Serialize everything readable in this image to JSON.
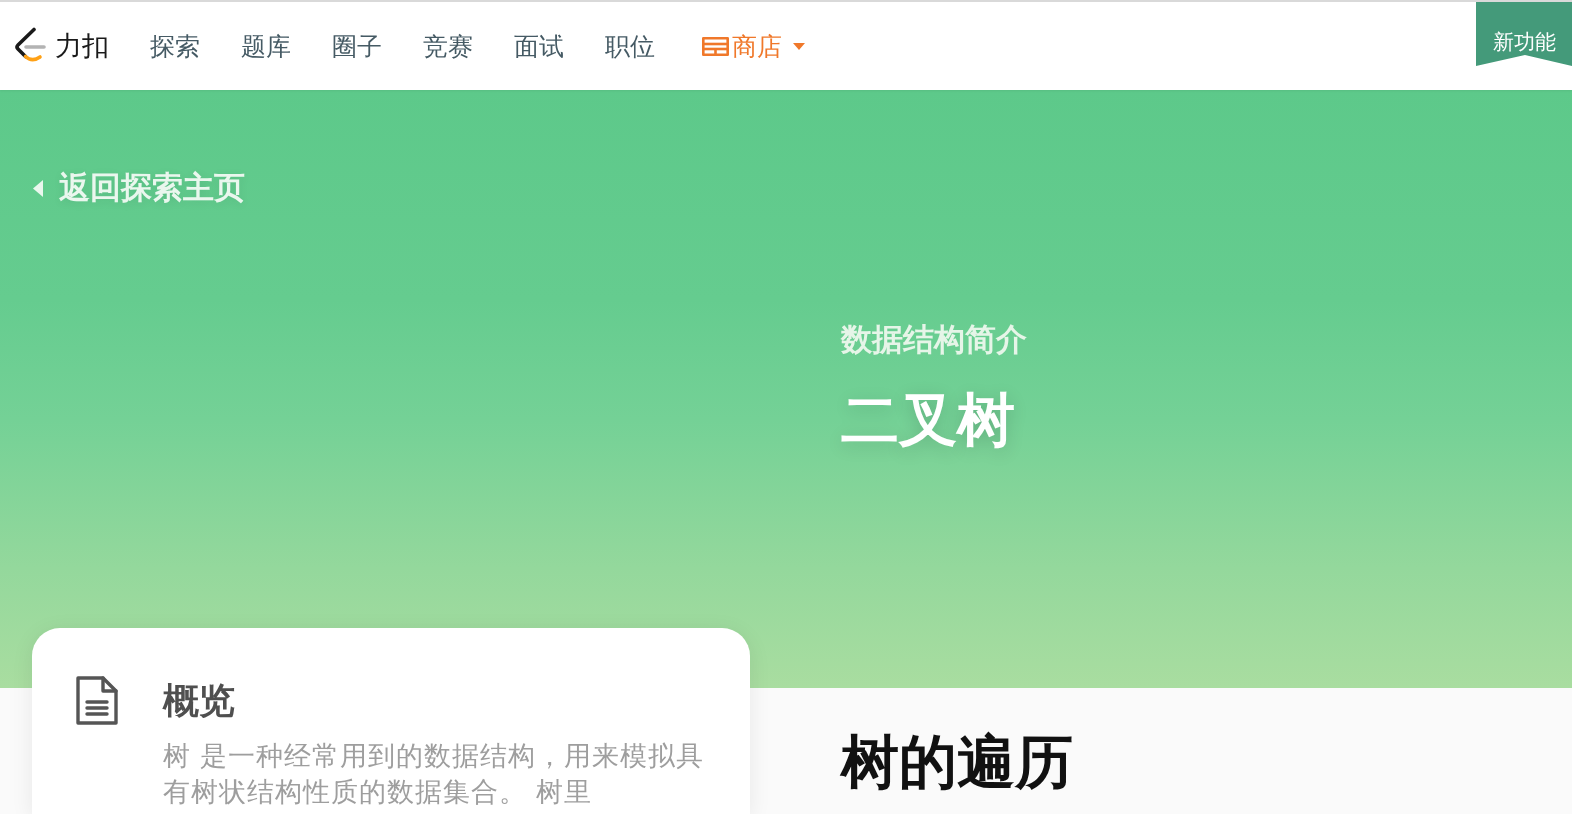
{
  "navbar": {
    "brand": "力扣",
    "items": [
      {
        "label": "探索",
        "kind": "link"
      },
      {
        "label": "题库",
        "kind": "link"
      },
      {
        "label": "圈子",
        "kind": "link"
      },
      {
        "label": "竞赛",
        "kind": "link"
      },
      {
        "label": "面试",
        "kind": "link"
      },
      {
        "label": "职位",
        "kind": "link"
      },
      {
        "label": "商店",
        "kind": "shop"
      }
    ],
    "ribbon": "新功能"
  },
  "hero": {
    "back_link": "返回探索主页",
    "subtitle": "数据结构简介",
    "title": "二叉树"
  },
  "overview_card": {
    "title": "概览",
    "description": "树 是一种经常用到的数据结构，用来模拟具有树状结构性质的数据集合。 树里"
  },
  "section": {
    "heading": "树的遍历"
  }
}
